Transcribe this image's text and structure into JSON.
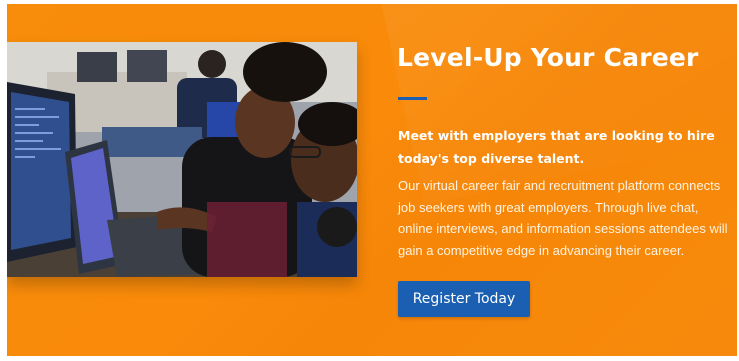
{
  "banner": {
    "title": "Level-Up Your Career",
    "lead": "Meet with employers that are looking to hire today's top diverse talent.",
    "body": "Our virtual career fair and recruitment platform connects job seekers with great employers. Through live chat, online interviews, and information sessions attendees will gain a competitive edge in advancing their career.",
    "cta_label": "Register Today"
  },
  "colors": {
    "banner_background": "#f78d0a",
    "accent_blue": "#1b5fb2",
    "text": "#ffffff"
  },
  "photo": {
    "icon": "photo-people-at-laptop"
  }
}
